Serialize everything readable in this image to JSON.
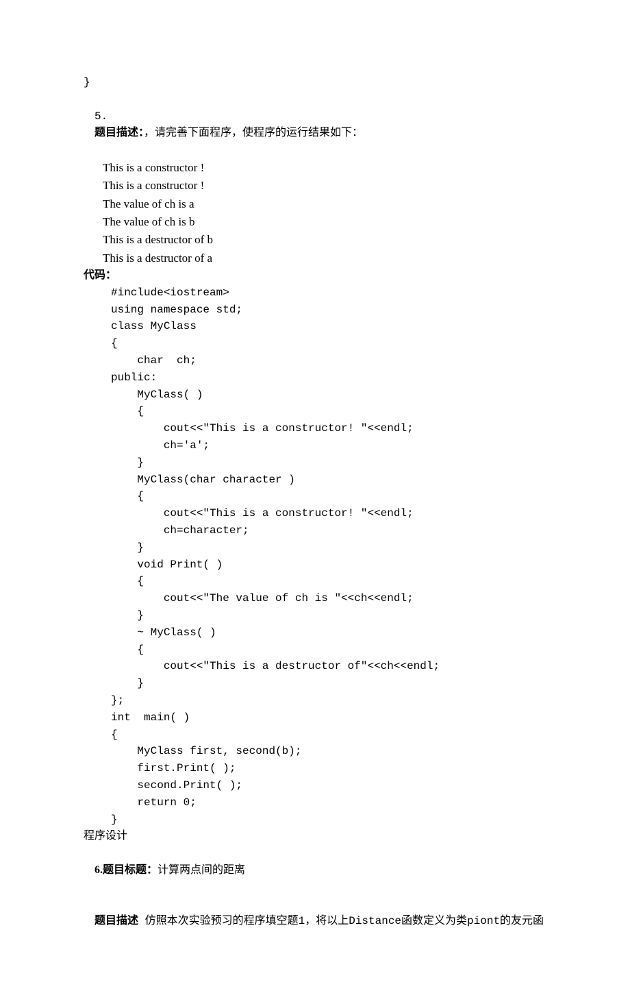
{
  "brace": "}",
  "q5": {
    "num": "5.",
    "label": "题目描述：",
    "desc": "，请完善下面程序，使程序的运行结果如下：",
    "outputs": [
      "This is a constructor !",
      "This is a constructor !",
      "The value of ch is a",
      "The value of ch is b",
      "This is a destructor of b",
      "This is a destructor of a"
    ],
    "codeLabel": "代码：",
    "code": [
      "#include<iostream>",
      "using namespace std;",
      "class MyClass",
      "{",
      "    char  ch;",
      "public:",
      "    MyClass( )",
      "    {",
      "        cout<<\"This is a constructor! \"<<endl;",
      "        ch='a';",
      "    }",
      "    MyClass(char character )",
      "    {",
      "        cout<<\"This is a constructor! \"<<endl;",
      "        ch=character;",
      "    }",
      "    void Print( )",
      "    {",
      "        cout<<\"The value of ch is \"<<ch<<endl;",
      "    }",
      "    ~ MyClass( )",
      "    {",
      "        cout<<\"This is a destructor of\"<<ch<<endl;",
      "    }",
      "};",
      "int  main( )",
      "{",
      "    MyClass first, second(b);",
      "    first.Print( );",
      "    second.Print( );",
      "    return 0;",
      "}"
    ]
  },
  "programDesign": "程序设计",
  "q6": {
    "titleLabel": "6.题目标题：",
    "titleText": "计算两点间的距离",
    "descLabel": "题目描述",
    "descText": " 仿照本次实验预习的程序填空题1，将以上Distance函数定义为类piont的友元函"
  }
}
